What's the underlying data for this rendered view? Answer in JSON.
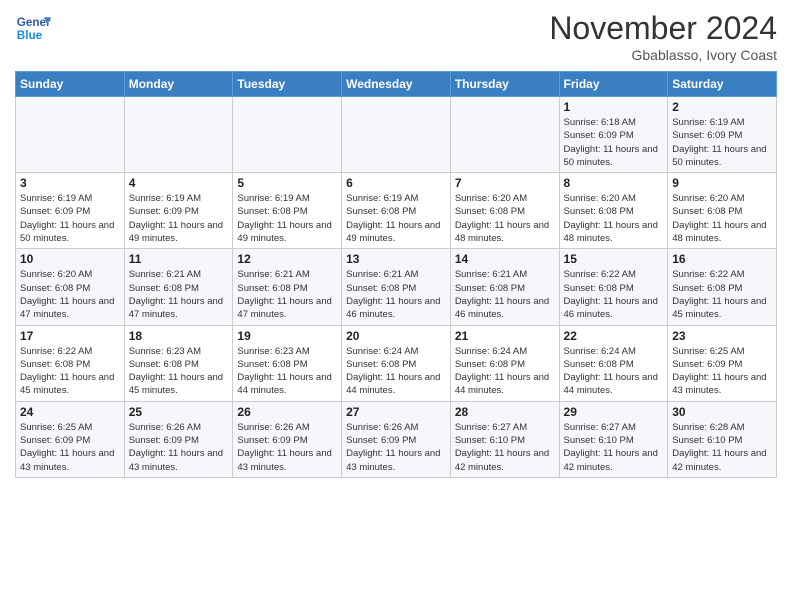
{
  "header": {
    "logo_line1": "General",
    "logo_line2": "Blue",
    "month_title": "November 2024",
    "location": "Gbablasso, Ivory Coast"
  },
  "weekdays": [
    "Sunday",
    "Monday",
    "Tuesday",
    "Wednesday",
    "Thursday",
    "Friday",
    "Saturday"
  ],
  "weeks": [
    [
      {
        "day": "",
        "content": ""
      },
      {
        "day": "",
        "content": ""
      },
      {
        "day": "",
        "content": ""
      },
      {
        "day": "",
        "content": ""
      },
      {
        "day": "",
        "content": ""
      },
      {
        "day": "1",
        "content": "Sunrise: 6:18 AM\nSunset: 6:09 PM\nDaylight: 11 hours\nand 50 minutes."
      },
      {
        "day": "2",
        "content": "Sunrise: 6:19 AM\nSunset: 6:09 PM\nDaylight: 11 hours\nand 50 minutes."
      }
    ],
    [
      {
        "day": "3",
        "content": "Sunrise: 6:19 AM\nSunset: 6:09 PM\nDaylight: 11 hours\nand 50 minutes."
      },
      {
        "day": "4",
        "content": "Sunrise: 6:19 AM\nSunset: 6:09 PM\nDaylight: 11 hours\nand 49 minutes."
      },
      {
        "day": "5",
        "content": "Sunrise: 6:19 AM\nSunset: 6:08 PM\nDaylight: 11 hours\nand 49 minutes."
      },
      {
        "day": "6",
        "content": "Sunrise: 6:19 AM\nSunset: 6:08 PM\nDaylight: 11 hours\nand 49 minutes."
      },
      {
        "day": "7",
        "content": "Sunrise: 6:20 AM\nSunset: 6:08 PM\nDaylight: 11 hours\nand 48 minutes."
      },
      {
        "day": "8",
        "content": "Sunrise: 6:20 AM\nSunset: 6:08 PM\nDaylight: 11 hours\nand 48 minutes."
      },
      {
        "day": "9",
        "content": "Sunrise: 6:20 AM\nSunset: 6:08 PM\nDaylight: 11 hours\nand 48 minutes."
      }
    ],
    [
      {
        "day": "10",
        "content": "Sunrise: 6:20 AM\nSunset: 6:08 PM\nDaylight: 11 hours\nand 47 minutes."
      },
      {
        "day": "11",
        "content": "Sunrise: 6:21 AM\nSunset: 6:08 PM\nDaylight: 11 hours\nand 47 minutes."
      },
      {
        "day": "12",
        "content": "Sunrise: 6:21 AM\nSunset: 6:08 PM\nDaylight: 11 hours\nand 47 minutes."
      },
      {
        "day": "13",
        "content": "Sunrise: 6:21 AM\nSunset: 6:08 PM\nDaylight: 11 hours\nand 46 minutes."
      },
      {
        "day": "14",
        "content": "Sunrise: 6:21 AM\nSunset: 6:08 PM\nDaylight: 11 hours\nand 46 minutes."
      },
      {
        "day": "15",
        "content": "Sunrise: 6:22 AM\nSunset: 6:08 PM\nDaylight: 11 hours\nand 46 minutes."
      },
      {
        "day": "16",
        "content": "Sunrise: 6:22 AM\nSunset: 6:08 PM\nDaylight: 11 hours\nand 45 minutes."
      }
    ],
    [
      {
        "day": "17",
        "content": "Sunrise: 6:22 AM\nSunset: 6:08 PM\nDaylight: 11 hours\nand 45 minutes."
      },
      {
        "day": "18",
        "content": "Sunrise: 6:23 AM\nSunset: 6:08 PM\nDaylight: 11 hours\nand 45 minutes."
      },
      {
        "day": "19",
        "content": "Sunrise: 6:23 AM\nSunset: 6:08 PM\nDaylight: 11 hours\nand 44 minutes."
      },
      {
        "day": "20",
        "content": "Sunrise: 6:24 AM\nSunset: 6:08 PM\nDaylight: 11 hours\nand 44 minutes."
      },
      {
        "day": "21",
        "content": "Sunrise: 6:24 AM\nSunset: 6:08 PM\nDaylight: 11 hours\nand 44 minutes."
      },
      {
        "day": "22",
        "content": "Sunrise: 6:24 AM\nSunset: 6:08 PM\nDaylight: 11 hours\nand 44 minutes."
      },
      {
        "day": "23",
        "content": "Sunrise: 6:25 AM\nSunset: 6:09 PM\nDaylight: 11 hours\nand 43 minutes."
      }
    ],
    [
      {
        "day": "24",
        "content": "Sunrise: 6:25 AM\nSunset: 6:09 PM\nDaylight: 11 hours\nand 43 minutes."
      },
      {
        "day": "25",
        "content": "Sunrise: 6:26 AM\nSunset: 6:09 PM\nDaylight: 11 hours\nand 43 minutes."
      },
      {
        "day": "26",
        "content": "Sunrise: 6:26 AM\nSunset: 6:09 PM\nDaylight: 11 hours\nand 43 minutes."
      },
      {
        "day": "27",
        "content": "Sunrise: 6:26 AM\nSunset: 6:09 PM\nDaylight: 11 hours\nand 43 minutes."
      },
      {
        "day": "28",
        "content": "Sunrise: 6:27 AM\nSunset: 6:10 PM\nDaylight: 11 hours\nand 42 minutes."
      },
      {
        "day": "29",
        "content": "Sunrise: 6:27 AM\nSunset: 6:10 PM\nDaylight: 11 hours\nand 42 minutes."
      },
      {
        "day": "30",
        "content": "Sunrise: 6:28 AM\nSunset: 6:10 PM\nDaylight: 11 hours\nand 42 minutes."
      }
    ]
  ]
}
